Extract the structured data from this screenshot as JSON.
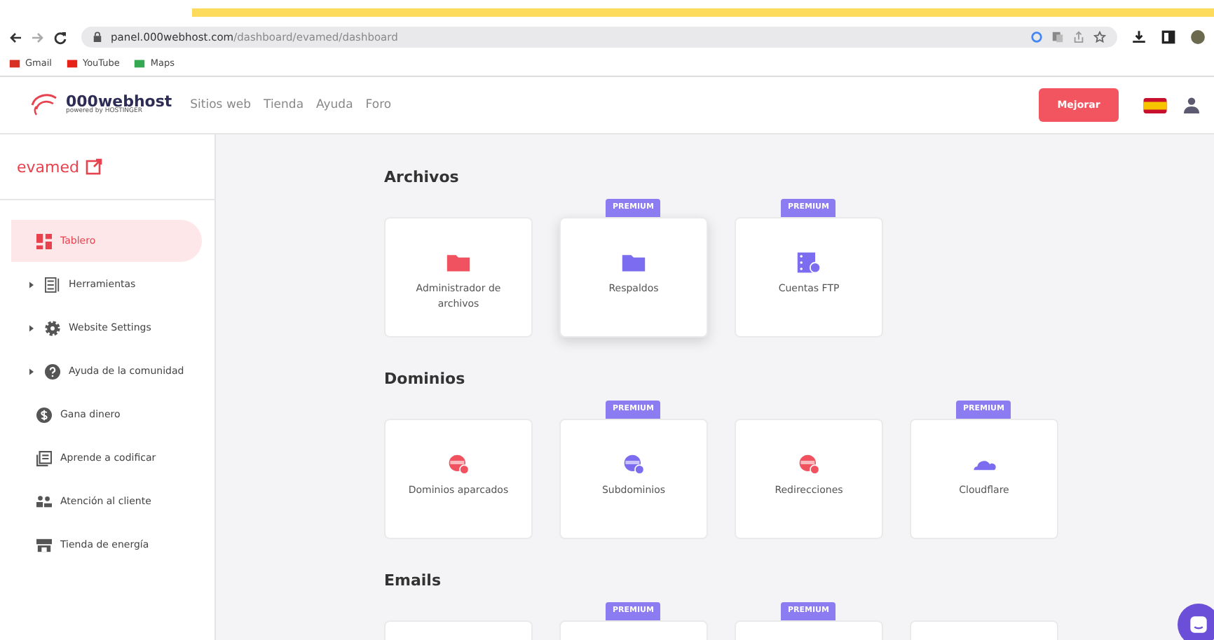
{
  "browser": {
    "url_host": "panel.000webhost.com",
    "url_path": "/dashboard/evamed/dashboard",
    "bookmarks": [
      "Gmail",
      "YouTube",
      "Maps"
    ]
  },
  "header": {
    "logo": "000webhost",
    "logo_sub": "powered by HOSTINGER",
    "nav": [
      "Sitios web",
      "Tienda",
      "Ayuda",
      "Foro"
    ],
    "upgrade_button": "Mejorar"
  },
  "sidebar": {
    "site": "evamed",
    "items": [
      {
        "label": "Tablero",
        "kind": "dashboard",
        "selected": true
      },
      {
        "label": "Herramientas",
        "kind": "list",
        "expanded": false,
        "selected": false
      },
      {
        "label": "Website Settings",
        "kind": "gear",
        "expanded": false,
        "selected": false
      },
      {
        "label": "Ayuda de la comunidad",
        "kind": "help",
        "expanded": false,
        "selected": false
      },
      {
        "label": "Gana dinero",
        "kind": "dollar",
        "selected": false
      },
      {
        "label": "Aprende a codificar",
        "kind": "book",
        "selected": false
      },
      {
        "label": "Atención al cliente",
        "kind": "people",
        "selected": false
      },
      {
        "label": "Tienda de energía",
        "kind": "store",
        "selected": false
      }
    ]
  },
  "sections": [
    {
      "title": "Archivos",
      "cards": [
        {
          "label": "Administrador de archivos",
          "kind": "folder",
          "color": "#f0535f",
          "highlighted": false
        },
        {
          "label": "Respaldos",
          "kind": "folder",
          "color": "#7c6cf0",
          "badge": "PREMIUM",
          "highlighted": true
        },
        {
          "label": "Cuentas FTP",
          "kind": "server",
          "color": "#7c6cf0",
          "badge": "PREMIUM",
          "highlighted": false
        }
      ]
    },
    {
      "title": "Dominios",
      "cards": [
        {
          "label": "Dominios aparcados",
          "kind": "globe",
          "color": "#f0535f",
          "highlighted": false
        },
        {
          "label": "Subdominios",
          "kind": "globe",
          "color": "#7c6cf0",
          "badge": "PREMIUM",
          "highlighted": false
        },
        {
          "label": "Redirecciones",
          "kind": "globe",
          "color": "#f0535f",
          "highlighted": false
        },
        {
          "label": "Cloudflare",
          "kind": "cloud",
          "color": "#7c6cf0",
          "badge": "PREMIUM",
          "highlighted": false
        }
      ]
    },
    {
      "title": "Emails",
      "cards": [
        {
          "highlighted": false
        },
        {
          "badge": "PREMIUM",
          "highlighted": false
        },
        {
          "badge": "PREMIUM",
          "highlighted": false
        },
        {
          "highlighted": false
        }
      ]
    }
  ]
}
